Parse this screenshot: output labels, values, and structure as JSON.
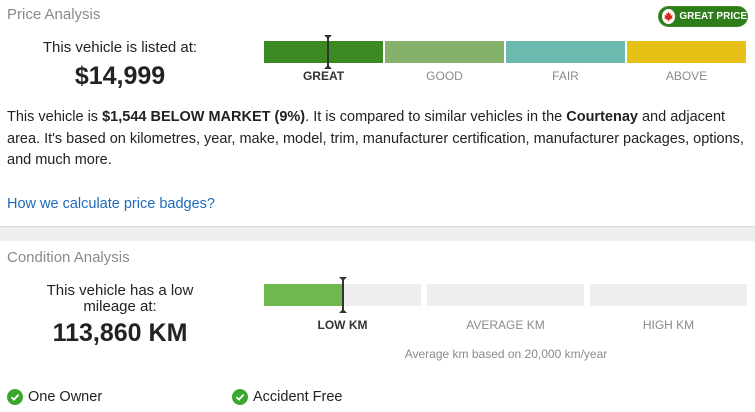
{
  "price_analysis": {
    "title": "Price Analysis",
    "badge": {
      "label": "GREAT PRICE",
      "color": "#2f7d1a"
    },
    "listed_label": "This vehicle is listed at:",
    "listed_price": "$14,999",
    "bands": [
      {
        "label": "GREAT",
        "color": "#3c8a22",
        "active": true
      },
      {
        "label": "GOOD",
        "color": "#85b26b",
        "active": false
      },
      {
        "label": "FAIR",
        "color": "#6cb9b0",
        "active": false
      },
      {
        "label": "ABOVE",
        "color": "#e6c014",
        "active": false
      }
    ],
    "desc": {
      "p1": "This vehicle is ",
      "below_market": "$1,544 BELOW MARKET (9%)",
      "p2": ". It is compared to similar vehicles in the ",
      "location": "Courtenay",
      "p3": " and adjacent area. It's based on kilometres, year, make, model, trim, manufacturer certification, manufacturer packages, options, and much more."
    },
    "link": "How we calculate price badges?"
  },
  "condition_analysis": {
    "title": "Condition Analysis",
    "km_label": "This vehicle has a low mileage at:",
    "km_value": "113,860 KM",
    "mileage_level_fraction": 0.5,
    "bands": [
      {
        "label": "LOW KM",
        "active": true
      },
      {
        "label": "AVERAGE KM",
        "active": false
      },
      {
        "label": "HIGH KM",
        "active": false
      }
    ],
    "fill_color": "#6fb84d",
    "note": "Average km based on 20,000 km/year"
  },
  "features": [
    {
      "label": "One Owner",
      "icon": "check-circle-icon"
    },
    {
      "label": "Accident Free",
      "icon": "check-circle-icon"
    }
  ]
}
